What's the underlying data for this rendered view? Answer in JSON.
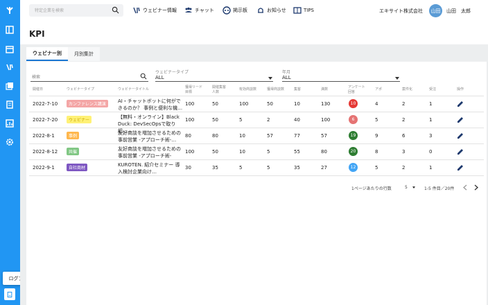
{
  "header": {
    "search_placeholder": "特定企業を検索",
    "nav": [
      {
        "label": "ウェビナー情報",
        "icon": "webinar-icon"
      },
      {
        "label": "チャット",
        "icon": "chat-people-icon"
      },
      {
        "label": "掲示板",
        "icon": "board-icon"
      },
      {
        "label": "お知らせ",
        "icon": "bell-icon"
      },
      {
        "label": "TIPS",
        "icon": "book-icon"
      }
    ],
    "company": "エキサイト株式会社",
    "avatar_initials": "山田",
    "username": "山田　太郎"
  },
  "page_title": "KPI",
  "tabs": [
    {
      "label": "ウェビナー別",
      "active": true
    },
    {
      "label": "月別集計",
      "active": false
    }
  ],
  "filters": {
    "search_placeholder": "検索",
    "type_label": "ウェビナータイプ",
    "type_value": "ALL",
    "month_label": "年月",
    "month_value": "ALL"
  },
  "table": {
    "headers": [
      "開催日",
      "ウェビナータイプ",
      "ウェビナータイトル",
      "獲得リード目標",
      "開催集客人数",
      "有効商談数",
      "獲得商談数",
      "集客",
      "満数",
      "アンケート回答",
      "アポ",
      "案件化",
      "受注",
      "操作"
    ],
    "rows": [
      {
        "date": "2022-7-10",
        "type": "カンファレンス講演",
        "type_color": "#f4a6a6",
        "title": "AI・チャットボットに何ができるのか？ 事例と便利な機…",
        "v1": "100",
        "v2": "50",
        "v3": "100",
        "v4": "50",
        "v5": "10",
        "v6": "130",
        "score": "10",
        "score_color": "#e53935",
        "a": "4",
        "b": "2",
        "c": "1"
      },
      {
        "date": "2022-7-20",
        "type": "ウェビナー",
        "type_color": "#fff176",
        "title": "【無料・オンライン】Black Duck: DevSecOpsで取り組…",
        "v1": "100",
        "v2": "50",
        "v3": "5",
        "v4": "2",
        "v5": "40",
        "v6": "100",
        "score": "6",
        "score_color": "#e57373",
        "a": "5",
        "b": "2",
        "c": "1"
      },
      {
        "date": "2022-8-1",
        "type": "事例",
        "type_color": "#ffb74d",
        "title": "友好商談を増加させるための事前営業 -アプローチ術-…",
        "v1": "80",
        "v2": "80",
        "v3": "10",
        "v4": "57",
        "v5": "77",
        "v6": "57",
        "score": "19",
        "score_color": "#2e7d32",
        "a": "9",
        "b": "6",
        "c": "3"
      },
      {
        "date": "2022-8-12",
        "type": "共催",
        "type_color": "#81c784",
        "title": "友好商談を増加させるための事前営業 -アプローチ術-",
        "v1": "100",
        "v2": "50",
        "v3": "10",
        "v4": "5",
        "v5": "55",
        "v6": "80",
        "score": "20",
        "score_color": "#2e7d32",
        "a": "8",
        "b": "3",
        "c": "0"
      },
      {
        "date": "2022-9-1",
        "type": "自社商材",
        "type_color": "#7e57c2",
        "title": "KUROTEN. 紹介セミナー 導入検討企業向け…",
        "v1": "30",
        "v2": "35",
        "v3": "5",
        "v4": "5",
        "v5": "35",
        "v6": "27",
        "score": "12",
        "score_color": "#42a5f5",
        "a": "5",
        "b": "2",
        "c": "1"
      }
    ]
  },
  "pagination": {
    "rows_label": "1ページあたりの行数",
    "rows_value": "5",
    "range": "1-5 件目／20件"
  },
  "logout_label": "ログアウト",
  "colors": {
    "accent": "#2196f3"
  }
}
